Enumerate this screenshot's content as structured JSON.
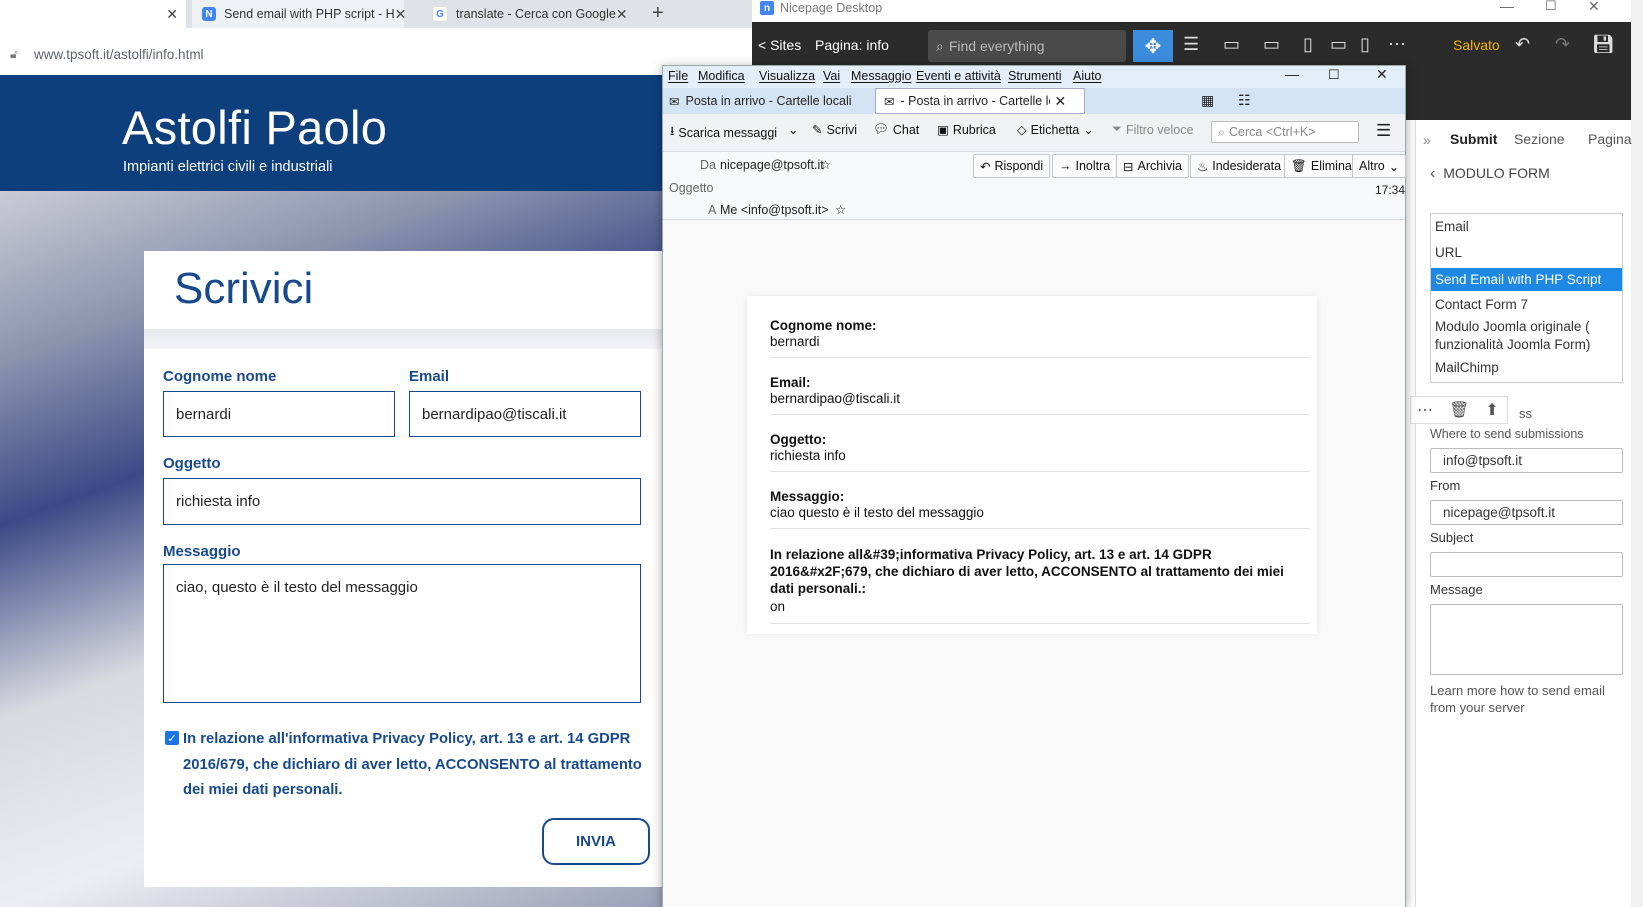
{
  "browser": {
    "tabs": [
      {
        "label": "Send email with PHP script - H",
        "favicon": "N"
      },
      {
        "label": "translate - Cerca con Google",
        "favicon": "G"
      }
    ],
    "url": "www.tpsoft.it/astolfi/info.html"
  },
  "site": {
    "title": "Astolfi Paolo",
    "subtitle": "Impianti elettrici civili e industriali",
    "form_title": "Scrivici",
    "fields": {
      "name_label": "Cognome nome",
      "name_value": "bernardi",
      "email_label": "Email",
      "email_value": "bernardipao@tiscali.it",
      "subject_label": "Oggetto",
      "subject_value": "richiesta info",
      "message_label": "Messaggio",
      "message_value": "ciao, questo è il testo del messaggio"
    },
    "privacy": "In relazione all'informativa Privacy Policy, art. 13 e art. 14 GDPR 2016/679, che dichiaro di aver letto, ACCONSENTO al trattamento dei miei dati personali.",
    "submit": "INVIA"
  },
  "nicepage": {
    "title": "Nicepage Desktop",
    "sites": "< Sites",
    "page": "Pagina: info",
    "find_placeholder": "Find everything",
    "saved": "Salvato",
    "panel_tabs": [
      "Submit",
      "Sezione",
      "Pagina"
    ],
    "back": "MODULO FORM",
    "options": [
      "Email",
      "URL",
      "Send Email with PHP Script",
      "Contact Form 7",
      "Modulo Joomla originale ( funzionalità Joomla Form)",
      "MailChimp"
    ],
    "ess_label": "ss",
    "where_label": "Where to send submissions",
    "where_value": "info@tpsoft.it",
    "from_label": "From",
    "from_value": "nicepage@tpsoft.it",
    "subject_label": "Subject",
    "message_label": "Message",
    "help": "Learn more how to send email from your server"
  },
  "thunderbird": {
    "menu": [
      "File",
      "Modifica",
      "Visualizza",
      "Vai",
      "Messaggio",
      "Eventi e attività",
      "Strumenti",
      "Aiuto"
    ],
    "tabs": [
      "Posta in arrivo - Cartelle locali",
      "- Posta in arrivo - Cartelle lo"
    ],
    "toolbar": {
      "scarica": "Scarica messaggi",
      "scrivi": "Scrivi",
      "chat": "Chat",
      "rubrica": "Rubrica",
      "etichetta": "Etichetta",
      "filtro": "Filtro veloce",
      "cerca": "Cerca <Ctrl+K>"
    },
    "header": {
      "da_label": "Da",
      "da_value": "nicepage@tpsoft.it",
      "oggetto_label": "Oggetto",
      "a_label": "A",
      "a_value": "Me <info@tpsoft.it>",
      "time": "17:34",
      "buttons": [
        "Rispondi",
        "Inoltra",
        "Archivia",
        "Indesiderata",
        "Elimina",
        "Altro"
      ]
    },
    "message": [
      {
        "key": "Cognome nome:",
        "value": "bernardi"
      },
      {
        "key": "Email:",
        "value": "bernardipao@tiscali.it"
      },
      {
        "key": "Oggetto:",
        "value": "richiesta info"
      },
      {
        "key": "Messaggio:",
        "value": "ciao questo è il testo del messaggio"
      },
      {
        "key": "In relazione all&#39;informativa Privacy Policy, art. 13 e art. 14 GDPR 2016&#x2F;679, che dichiaro di aver letto, ACCONSENTO al trattamento dei miei dati personali.:",
        "value": "on"
      }
    ]
  }
}
